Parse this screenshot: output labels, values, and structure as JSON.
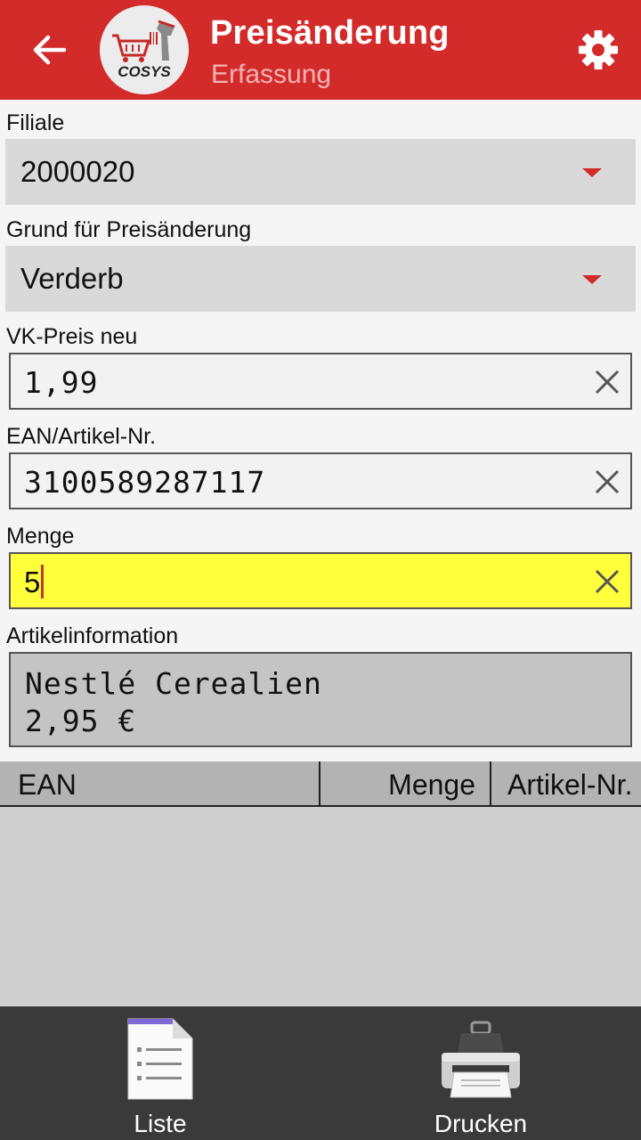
{
  "header": {
    "title": "Preisänderung",
    "subtitle": "Erfassung"
  },
  "form": {
    "filiale": {
      "label": "Filiale",
      "value": "2000020"
    },
    "grund": {
      "label": "Grund für Preisänderung",
      "value": "Verderb"
    },
    "vk_preis": {
      "label": "VK-Preis neu",
      "value": "1,99"
    },
    "ean": {
      "label": "EAN/Artikel-Nr.",
      "value": "3100589287117"
    },
    "menge": {
      "label": "Menge",
      "value": "5"
    },
    "artikelinfo": {
      "label": "Artikelinformation",
      "line1": "Nestlé Cerealien",
      "line2": "2,95 €"
    }
  },
  "table": {
    "columns": [
      "EAN",
      "Menge",
      "Artikel-Nr."
    ]
  },
  "bottom_nav": {
    "liste": "Liste",
    "drucken": "Drucken"
  },
  "colors": {
    "accent": "#d32a2a",
    "active_field": "#ffff3c",
    "bottom_bar": "#3a3a3a"
  },
  "icons": [
    "back-arrow-icon",
    "cosys-logo",
    "gear-icon",
    "clear-icon",
    "dropdown-caret-icon",
    "list-document-icon",
    "printer-icon"
  ]
}
